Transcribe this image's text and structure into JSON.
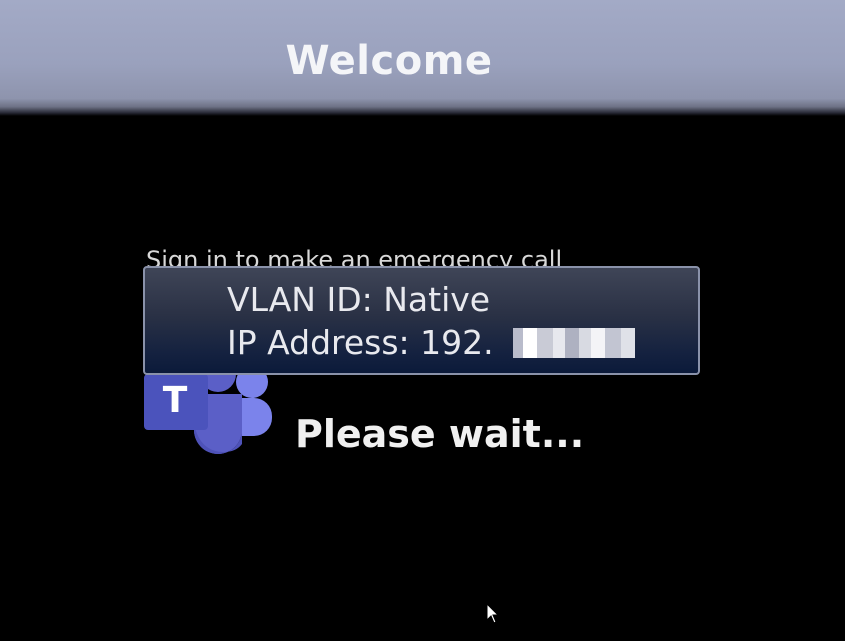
{
  "header": {
    "title": "Welcome"
  },
  "main": {
    "emergency_text": "Sign in to make an emergency call",
    "status_text": "Please wait...",
    "logo_letter": "T"
  },
  "network_popup": {
    "vlan_line": "VLAN ID: Native",
    "ip_line": "IP Address: 192."
  },
  "colors": {
    "header_bg": "#9aa1bd",
    "popup_bg": "#1b2540",
    "teams_purple": "#5b5fc7"
  },
  "icons": [
    "teams-logo-icon",
    "mouse-cursor-icon"
  ]
}
